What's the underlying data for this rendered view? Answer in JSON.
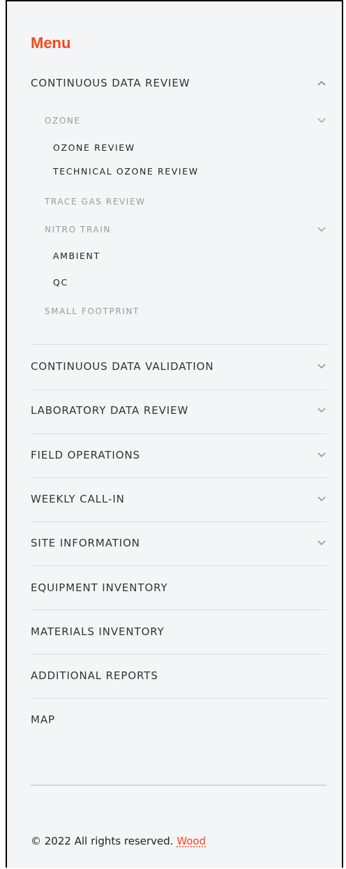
{
  "menu": {
    "title": "Menu",
    "continuous_data_review": {
      "label": "CONTINUOUS DATA REVIEW",
      "ozone": {
        "label": "OZONE",
        "ozone_review": "OZONE REVIEW",
        "technical_ozone_review": "TECHNICAL OZONE REVIEW"
      },
      "trace_gas_review": "TRACE GAS REVIEW",
      "nitro_train": {
        "label": "NITRO TRAIN",
        "ambient": "AMBIENT",
        "qc": "QC"
      },
      "small_footprint": "SMALL FOOTPRINT"
    },
    "continuous_data_validation": "CONTINUOUS DATA VALIDATION",
    "laboratory_data_review": "LABORATORY DATA REVIEW",
    "field_operations": "FIELD OPERATIONS",
    "weekly_call_in": "WEEKLY CALL-IN",
    "site_information": "SITE INFORMATION",
    "equipment_inventory": "EQUIPMENT INVENTORY",
    "materials_inventory": "MATERIALS INVENTORY",
    "additional_reports": "ADDITIONAL REPORTS",
    "map": "MAP"
  },
  "footer": {
    "copyright": "© 2022 All rights reserved.",
    "company": "Wood"
  },
  "icons": {
    "expanded": "chevron-up-icon",
    "collapsed": "chevron-down-icon"
  },
  "colors": {
    "accent": "#f04a1c",
    "panel_background": "#f4f5f7",
    "muted_text": "#9a9a9a",
    "text": "#333333",
    "divider": "#d9dbe0"
  }
}
